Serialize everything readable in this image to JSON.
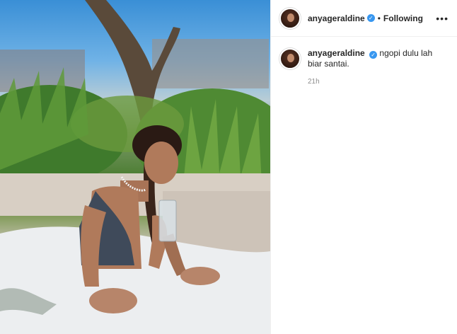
{
  "post": {
    "author": "anyageraldine",
    "separator": "•",
    "follow_status": "Following",
    "more_icon": "more-horizontal-icon"
  },
  "caption": {
    "author": "anyageraldine",
    "text": "ngopi dulu lah biar santai.",
    "time": "21h"
  },
  "colors": {
    "verified": "#3897f0",
    "border": "#efefef",
    "muted": "#8e8e8e"
  }
}
